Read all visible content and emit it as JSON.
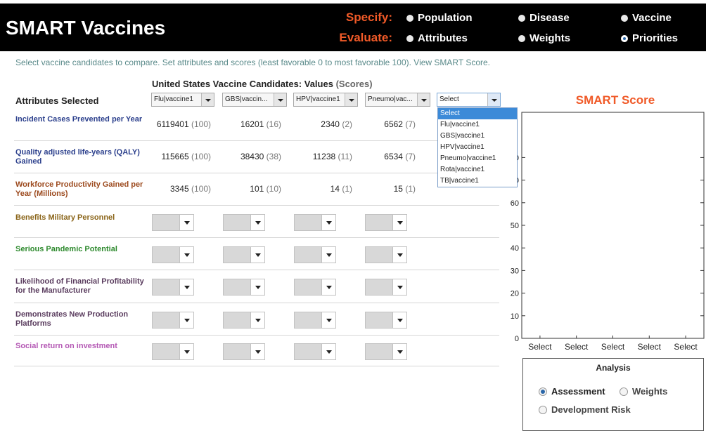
{
  "header": {
    "title": "SMART Vaccines",
    "specify_label": "Specify:",
    "evaluate_label": "Evaluate:",
    "nav_specify": [
      "Population",
      "Disease",
      "Vaccine"
    ],
    "nav_evaluate": [
      "Attributes",
      "Weights",
      "Priorities"
    ],
    "selected_nav": "Priorities"
  },
  "instructions": "Select vaccine candidates to compare. Set attributes and scores (least favorable 0 to most favorable 100). View SMART Score.",
  "table": {
    "title": "United States Vaccine Candidates: Values",
    "title_scores": "(Scores)",
    "attributes_header": "Attributes Selected",
    "candidate_selects": [
      "Flu|vaccine1",
      "GBS|vaccin...",
      "HPV|vaccine1",
      "Pneumo|vac...",
      "Select"
    ],
    "dropdown_options": [
      "Select",
      "Flu|vaccine1",
      "GBS|vaccine1",
      "HPV|vaccine1",
      "Pneumo|vaccine1",
      "Rota|vaccine1",
      "TB|vaccine1"
    ],
    "dropdown_highlighted": "Select",
    "rows": [
      {
        "label": "Incident Cases Prevented per Year",
        "color": "#2b3f8c",
        "values": [
          "6119401",
          "16201",
          "2340",
          "6562"
        ],
        "scores": [
          "(100)",
          "(16)",
          "(2)",
          "(7)"
        ]
      },
      {
        "label": "Quality adjusted life-years (QALY) Gained",
        "color": "#2b3f8c",
        "values": [
          "115665",
          "38430",
          "11238",
          "6534"
        ],
        "scores": [
          "(100)",
          "(38)",
          "(11)",
          "(7)"
        ]
      },
      {
        "label": "Workforce Productivity Gained per Year (Millions)",
        "color": "#9c4a1e",
        "values": [
          "3345",
          "101",
          "14",
          "15"
        ],
        "scores": [
          "(100)",
          "(10)",
          "(1)",
          "(1)"
        ]
      },
      {
        "label": "Benefits Military Personnel",
        "color": "#8a6418"
      },
      {
        "label": "Serious Pandemic Potential",
        "color": "#2e8a2e"
      },
      {
        "label": "Likelihood of Financial Profitability for the Manufacturer",
        "color": "#5a3c5e"
      },
      {
        "label": "Demonstrates New Production Platforms",
        "color": "#5a3c5e"
      },
      {
        "label": "Social return on investment",
        "color": "#b458b4"
      }
    ]
  },
  "chart_data": {
    "type": "bar",
    "title": "SMART Score",
    "categories": [
      "Select",
      "Select",
      "Select",
      "Select",
      "Select"
    ],
    "values": [
      0,
      0,
      0,
      0,
      0
    ],
    "ylim": [
      0,
      100
    ],
    "y_ticks": [
      "0",
      "10",
      "20",
      "30",
      "40",
      "50",
      "60",
      "70",
      "80"
    ],
    "grid": false
  },
  "analysis": {
    "title": "Analysis",
    "options": [
      "Assessment",
      "Weights",
      "Development Risk"
    ],
    "selected": "Assessment"
  },
  "colors": {
    "accent": "#f05a28",
    "header_bg": "#000000",
    "instructions": "#5a8a8a"
  }
}
